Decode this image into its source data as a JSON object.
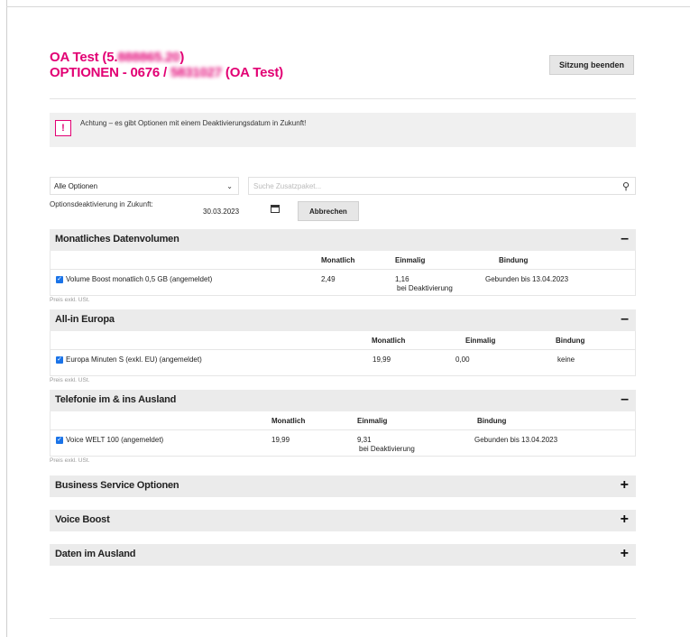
{
  "header": {
    "title_prefix": "OA Test (5.",
    "title_prefix_blur": "888865.20",
    "title_prefix_end": ")",
    "title2_prefix": "OPTIONEN - 0676 / ",
    "title2_blur": "5831027",
    "title2_suffix": " (OA Test)",
    "end_session": "Sitzung beenden"
  },
  "alert": {
    "text": "Achtung – es gibt Optionen mit einem Deaktivierungsdatum in Zukunft!",
    "icon": "!"
  },
  "filters": {
    "select_value": "Alle Optionen",
    "search_placeholder": "Suche Zusatzpaket..."
  },
  "deactivation": {
    "label": "Optionsdeaktivierung in Zukunft:",
    "date": "30.03.2023",
    "cancel": "Abbrechen"
  },
  "sections": [
    {
      "title": "Monatliches Datenvolumen",
      "toggle": "–",
      "headers": [
        "Monatlich",
        "Einmalig",
        "Bindung"
      ],
      "row": {
        "name": "Volume Boost monatlich 0,5 GB (angemeldet)",
        "monthly": "2,49",
        "once": "1,16",
        "once_note": "bei Deaktivierung",
        "binding": "Gebunden bis 13.04.2023"
      },
      "note": "Preis exkl. USt."
    },
    {
      "title": "All-in Europa",
      "toggle": "–",
      "headers": [
        "Monatlich",
        "Einmalig",
        "Bindung"
      ],
      "row": {
        "name": "Europa Minuten S (exkl. EU) (angemeldet)",
        "monthly": "19,99",
        "once": "0,00",
        "binding": "keine"
      },
      "note": "Preis exkl. USt."
    },
    {
      "title": "Telefonie im & ins Ausland",
      "toggle": "–",
      "headers": [
        "Monatlich",
        "Einmalig",
        "Bindung"
      ],
      "row": {
        "name": "Voice WELT 100 (angemeldet)",
        "monthly": "19,99",
        "once": "9,31",
        "once_note": "bei Deaktivierung",
        "binding": "Gebunden bis 13.04.2023"
      },
      "note": "Preis exkl. USt."
    }
  ],
  "collapsed": [
    {
      "title": "Business Service Optionen",
      "toggle": "+"
    },
    {
      "title": "Voice Boost",
      "toggle": "+"
    },
    {
      "title": "Daten im Ausland",
      "toggle": "+"
    }
  ]
}
